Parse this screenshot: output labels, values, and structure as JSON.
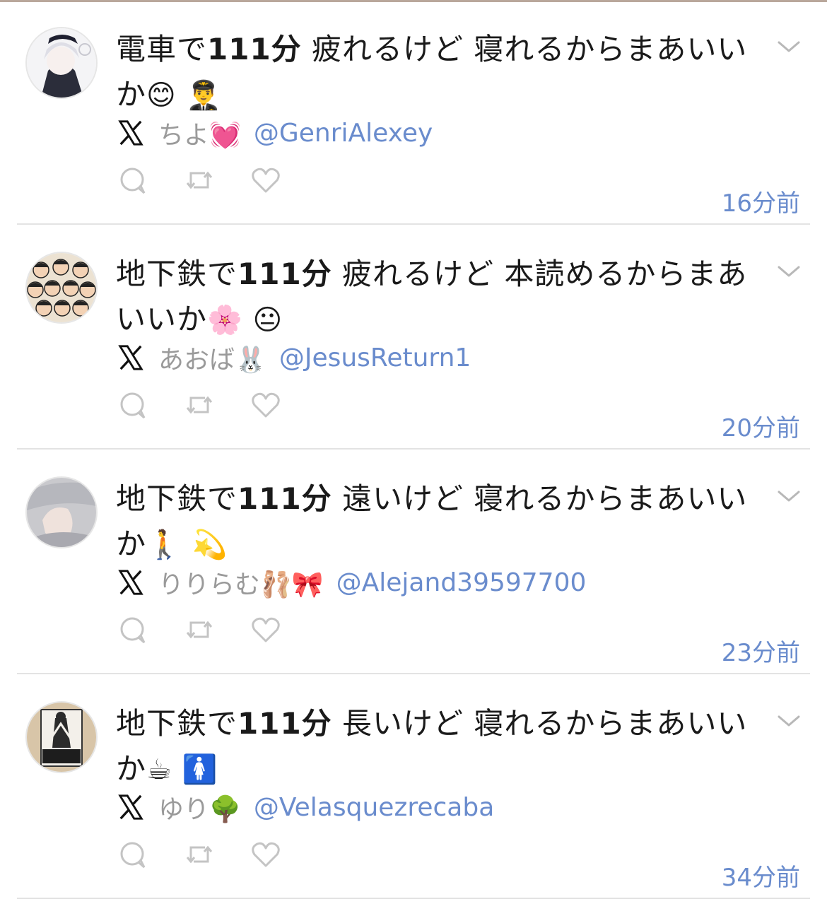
{
  "colors": {
    "link": "#6a8ccd",
    "muted": "#9a9a9a",
    "text": "#1a1a1a"
  },
  "posts": [
    {
      "avatar": "avatar-anime-girl",
      "text_a": "電車で",
      "text_bold": "111分",
      "text_b": " 疲れるけど 寝れるからまあいいか",
      "emoji": "😊 👨‍✈️",
      "author_name": "ちよ💓",
      "handle": "@GenriAlexey",
      "time": "16分前"
    },
    {
      "avatar": "avatar-crowd",
      "text_a": "地下鉄で",
      "text_bold": "111分",
      "text_b": " 疲れるけど 本読めるからまあいいか",
      "emoji": "🌸 😐",
      "author_name": "あおば🐰",
      "handle": "@JesusReturn1",
      "time": "20分前"
    },
    {
      "avatar": "avatar-blurred",
      "text_a": "地下鉄で",
      "text_bold": "111分",
      "text_b": " 遠いけど 寝れるからまあいいか",
      "emoji": "🚶 💫",
      "author_name": "りりらむ🩰🎀",
      "handle": "@Alejand39597700",
      "time": "23分前"
    },
    {
      "avatar": "avatar-calpis",
      "text_a": "地下鉄で",
      "text_bold": "111分",
      "text_b": " 長いけど 寝れるからまあいいか",
      "emoji": "☕ 🚺",
      "author_name": "ゆり🌳",
      "handle": "@Velasquezrecaba",
      "time": "34分前"
    }
  ]
}
